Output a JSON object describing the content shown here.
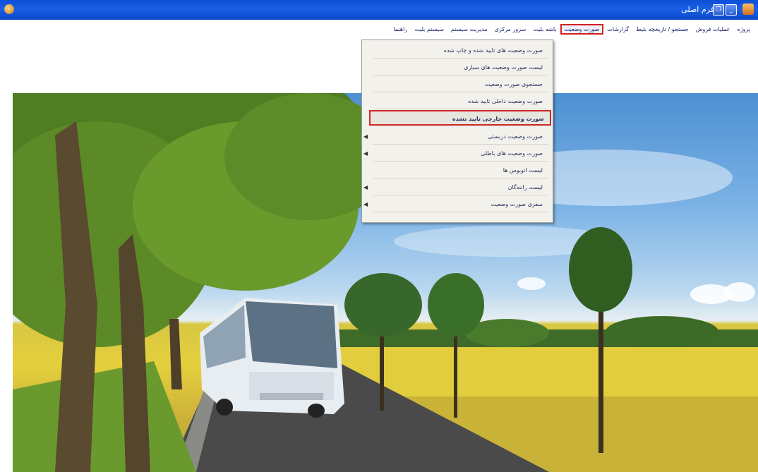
{
  "window": {
    "title": "فرم اصلی",
    "title_bar_buttons": [
      "restore",
      "minimize"
    ]
  },
  "menubar": {
    "items": [
      {
        "label": "پروژه"
      },
      {
        "label": "عملیات فروش"
      },
      {
        "label": "جستجو / تاریخچه بلیط"
      },
      {
        "label": "گزارشات"
      },
      {
        "label": "صورت وضعیت",
        "active": true
      },
      {
        "label": "باشه بلیت"
      },
      {
        "label": "سرور مرکزی"
      },
      {
        "label": "مدیریت سیستم"
      },
      {
        "label": "سیستم بلیت"
      },
      {
        "label": "راهنما"
      }
    ]
  },
  "dropdown": {
    "items": [
      {
        "label": "صورت وضعیت های تایید شده و چاپ شده",
        "submenu": false
      },
      {
        "label": "لیست صورت وضعیت های سیاری",
        "submenu": false
      },
      {
        "label": "جستجوی صورت وضعیت",
        "submenu": false
      },
      {
        "label": "صورت وضعیت داخلی تایید شده",
        "submenu": false
      },
      {
        "label": "صورت وضعیت خارجی تایید نشده",
        "submenu": false,
        "highlighted": true
      },
      {
        "label": "صورت وضعیت دربستی",
        "submenu": true
      },
      {
        "label": "صورت وضعیت های باطلی",
        "submenu": true
      },
      {
        "label": "لیست اتوبوس ها",
        "submenu": false
      },
      {
        "label": "لیست رانندگان",
        "submenu": true
      },
      {
        "label": "سفری صورت وضعیت",
        "submenu": true
      }
    ]
  },
  "colors": {
    "title_bar": "#1a5fe6",
    "highlight_border": "#d32020",
    "menu_text": "#1b2470"
  }
}
